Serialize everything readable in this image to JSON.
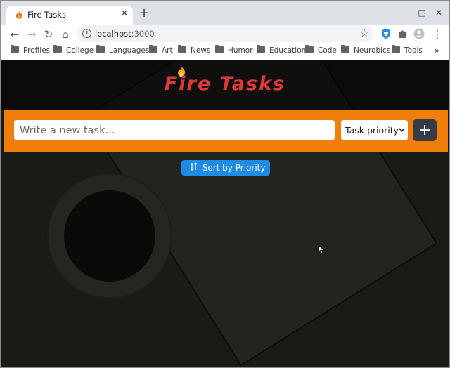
{
  "browser": {
    "tab": {
      "title": "Fire Tasks",
      "close": "✕",
      "favicon": "flame-icon"
    },
    "new_tab": "+",
    "window_controls": {
      "minimize": "–",
      "maximize": "□",
      "close": "✕"
    },
    "toolbar": {
      "back": "←",
      "forward": "→",
      "reload": "↻",
      "home": "⌂",
      "star": "☆",
      "menu": "⋮"
    },
    "address": {
      "host": "localhost",
      "port": ":3000",
      "info": "i"
    },
    "bookmarks": [
      "Profiles",
      "College",
      "Languages",
      "Art",
      "News",
      "Humor",
      "Education",
      "Code",
      "Neurobics",
      "Tools"
    ],
    "bookmarks_more": "»"
  },
  "app": {
    "brand": "Fire Tasks",
    "task_input": {
      "placeholder": "Write a new task...",
      "value": ""
    },
    "priority_select": {
      "selected": "Task priority",
      "arrow": "⌄"
    },
    "add_button": "+",
    "sort_button": "Sort by Priority",
    "sort_icon": "↓↑",
    "colors": {
      "bar": "#f17d0a",
      "brand": "#e0373a",
      "sort": "#1e8ce6",
      "add": "#353c48"
    }
  }
}
